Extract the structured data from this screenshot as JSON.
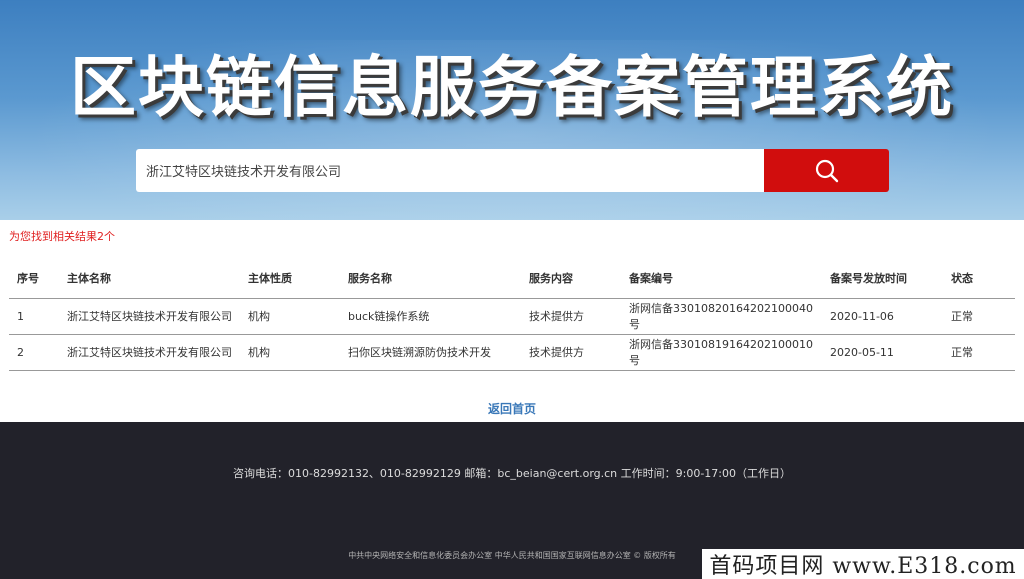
{
  "header": {
    "title": "区块链信息服务备案管理系统",
    "search_value": "浙江艾特区块链技术开发有限公司",
    "search_icon": "search-icon"
  },
  "results": {
    "count_text": "为您找到相关结果2个",
    "columns": [
      "序号",
      "主体名称",
      "主体性质",
      "服务名称",
      "服务内容",
      "备案编号",
      "备案号发放时间",
      "状态"
    ],
    "rows": [
      [
        "1",
        "浙江艾特区块链技术开发有限公司",
        "机构",
        "buck链操作系统",
        "技术提供方",
        "浙网信备33010820164202100040号",
        "2020-11-06",
        "正常"
      ],
      [
        "2",
        "浙江艾特区块链技术开发有限公司",
        "机构",
        "扫你区块链溯源防伪技术开发",
        "技术提供方",
        "浙网信备33010819164202100010号",
        "2020-05-11",
        "正常"
      ]
    ]
  },
  "home_link": "返回首页",
  "footer": {
    "contact": "咨询电话：010-82992132、010-82992129   邮箱：bc_beian@cert.org.cn   工作时间：9:00-17:00（工作日）",
    "copyright": "中共中央网络安全和信息化委员会办公室   中华人民共和国国家互联网信息办公室 © 版权所有"
  },
  "watermark": "首码项目网 www.E318.com",
  "colors": {
    "accent_red": "#d10d0d",
    "link_blue": "#3a78b8",
    "footer_bg": "#22222a"
  }
}
